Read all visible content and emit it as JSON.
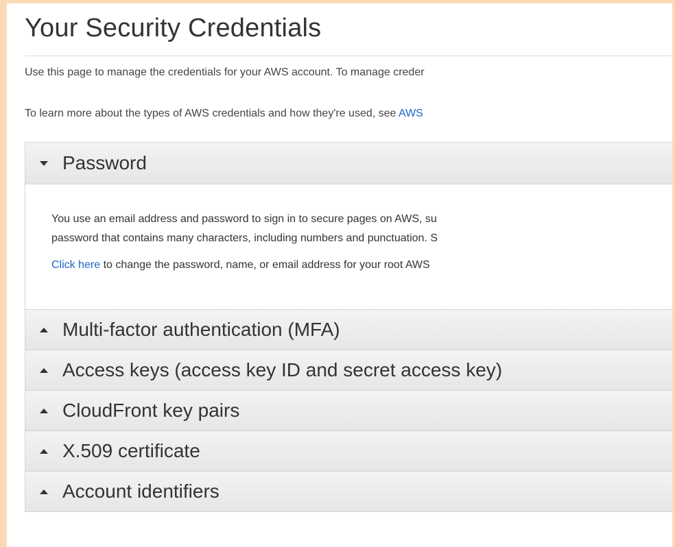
{
  "page": {
    "title": "Your Security Credentials",
    "intro_line_1": "Use this page to manage the credentials for your AWS account. To manage creder",
    "intro_line_2_text": "To learn more about the types of AWS credentials and how they're used, see ",
    "intro_line_2_link": "AWS"
  },
  "colors": {
    "background": "#fcd9b6",
    "link": "#1a66c7",
    "panel_header": "#ececec"
  },
  "panels": [
    {
      "title": "Password",
      "expanded": true,
      "caret_icon": "caret-down-icon",
      "body": {
        "line_1": "You use an email address and password to sign in to secure pages on AWS, su",
        "line_2": "password that contains many characters, including numbers and punctuation. S",
        "link_text": "Click here",
        "link_followup": " to change the password, name, or email address for your root AWS"
      }
    },
    {
      "title": "Multi-factor authentication (MFA)",
      "expanded": false,
      "caret_icon": "caret-up-icon"
    },
    {
      "title": "Access keys (access key ID and secret access key)",
      "expanded": false,
      "caret_icon": "caret-up-icon"
    },
    {
      "title": "CloudFront key pairs",
      "expanded": false,
      "caret_icon": "caret-up-icon"
    },
    {
      "title": "X.509 certificate",
      "expanded": false,
      "caret_icon": "caret-up-icon"
    },
    {
      "title": "Account identifiers",
      "expanded": false,
      "caret_icon": "caret-up-icon"
    }
  ]
}
